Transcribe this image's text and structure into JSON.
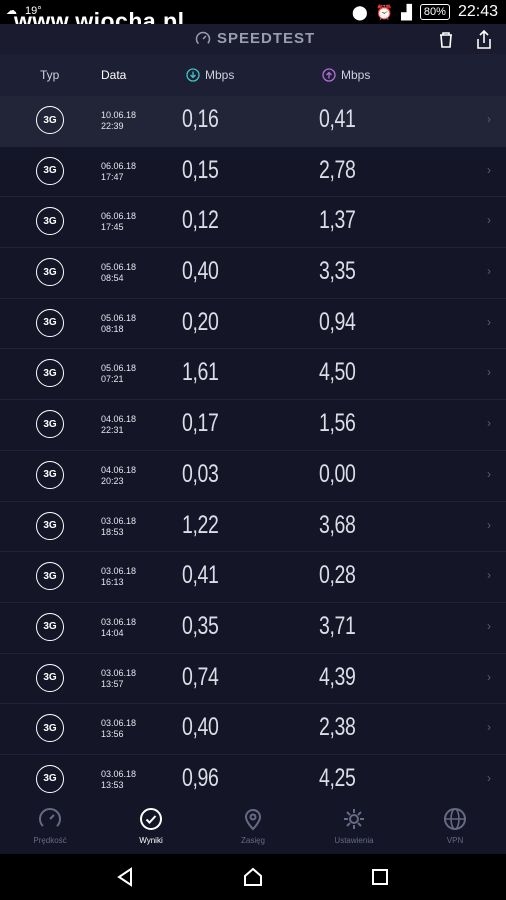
{
  "status_bar": {
    "watermark": "www.wiocha.pl",
    "temperature": "19°",
    "battery": "80%",
    "time": "22:43"
  },
  "header": {
    "title": "SPEEDTEST",
    "icons": [
      "speedometer-icon",
      "trash-icon",
      "share-icon"
    ]
  },
  "columns": {
    "type": "Typ",
    "date": "Data",
    "download": "Mbps",
    "upload": "Mbps"
  },
  "results": [
    {
      "type": "3G",
      "date": "10.06.18",
      "time": "22:39",
      "download": "0,16",
      "upload": "0,41"
    },
    {
      "type": "3G",
      "date": "06.06.18",
      "time": "17:47",
      "download": "0,15",
      "upload": "2,78"
    },
    {
      "type": "3G",
      "date": "06.06.18",
      "time": "17:45",
      "download": "0,12",
      "upload": "1,37"
    },
    {
      "type": "3G",
      "date": "05.06.18",
      "time": "08:54",
      "download": "0,40",
      "upload": "3,35"
    },
    {
      "type": "3G",
      "date": "05.06.18",
      "time": "08:18",
      "download": "0,20",
      "upload": "0,94"
    },
    {
      "type": "3G",
      "date": "05.06.18",
      "time": "07:21",
      "download": "1,61",
      "upload": "4,50"
    },
    {
      "type": "3G",
      "date": "04.06.18",
      "time": "22:31",
      "download": "0,17",
      "upload": "1,56"
    },
    {
      "type": "3G",
      "date": "04.06.18",
      "time": "20:23",
      "download": "0,03",
      "upload": "0,00"
    },
    {
      "type": "3G",
      "date": "03.06.18",
      "time": "18:53",
      "download": "1,22",
      "upload": "3,68"
    },
    {
      "type": "3G",
      "date": "03.06.18",
      "time": "16:13",
      "download": "0,41",
      "upload": "0,28"
    },
    {
      "type": "3G",
      "date": "03.06.18",
      "time": "14:04",
      "download": "0,35",
      "upload": "3,71"
    },
    {
      "type": "3G",
      "date": "03.06.18",
      "time": "13:57",
      "download": "0,74",
      "upload": "4,39"
    },
    {
      "type": "3G",
      "date": "03.06.18",
      "time": "13:56",
      "download": "0,40",
      "upload": "2,38"
    },
    {
      "type": "3G",
      "date": "03.06.18",
      "time": "13:53",
      "download": "0,96",
      "upload": "4,25"
    }
  ],
  "bottom_nav": [
    {
      "label": "Prędkość",
      "icon": "gauge-icon",
      "active": false
    },
    {
      "label": "Wyniki",
      "icon": "check-circle-icon",
      "active": true
    },
    {
      "label": "Zasięg",
      "icon": "location-pin-icon",
      "active": false
    },
    {
      "label": "Ustawienia",
      "icon": "gear-icon",
      "active": false
    },
    {
      "label": "VPN",
      "icon": "globe-icon",
      "active": false
    }
  ],
  "colors": {
    "background": "#141526",
    "download_accent": "#3fc5c5",
    "upload_accent": "#b26dd8"
  }
}
